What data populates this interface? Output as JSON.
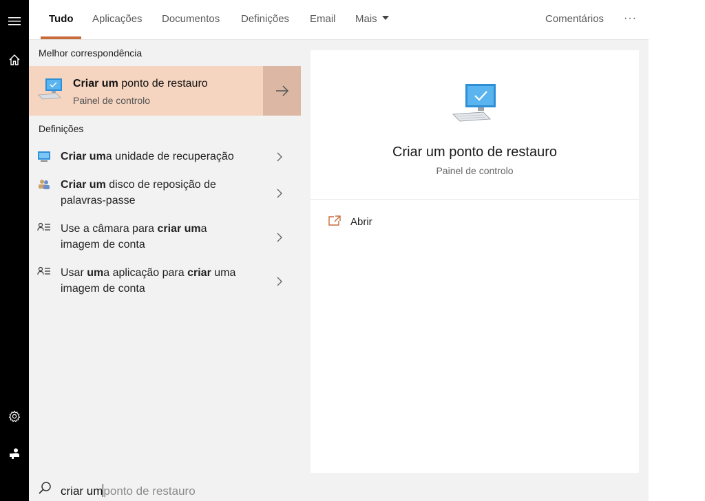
{
  "rail": {
    "icons": [
      "hamburger-icon",
      "home-icon",
      "gear-icon",
      "user-icon"
    ]
  },
  "tabs": {
    "all": "Tudo",
    "apps": "Aplicações",
    "documents": "Documentos",
    "settings": "Definições",
    "email": "Email",
    "more": "Mais",
    "feedback": "Comentários",
    "options": "···"
  },
  "best_match": {
    "section_title": "Melhor correspondência",
    "title_bold": "Criar um",
    "title_rest": " ponto de restauro",
    "subtitle": "Painel de controlo"
  },
  "settings_section": {
    "title": "Definições",
    "results": [
      {
        "parts": [
          "Criar um",
          "a unidade de recuperação"
        ]
      },
      {
        "parts": [
          "Criar um",
          " disco de reposição de palavras-passe"
        ]
      },
      {
        "parts": [
          "Use a câmara para ",
          "criar um",
          "a imagem de conta"
        ]
      },
      {
        "parts": [
          "Usar ",
          "um",
          "a aplicação para ",
          "criar",
          " uma imagem de conta"
        ]
      }
    ]
  },
  "preview": {
    "title": "Criar um ponto de restauro",
    "subtitle": "Painel de controlo",
    "open_label": "Abrir"
  },
  "search": {
    "typed": "criar um",
    "suggestion": "ponto de restauro"
  },
  "colors": {
    "accent": "#c86b3a",
    "selected_bg": "#f5d4c0",
    "selected_arrow_bg": "#dcb7a4",
    "rail_bg": "#000000"
  }
}
